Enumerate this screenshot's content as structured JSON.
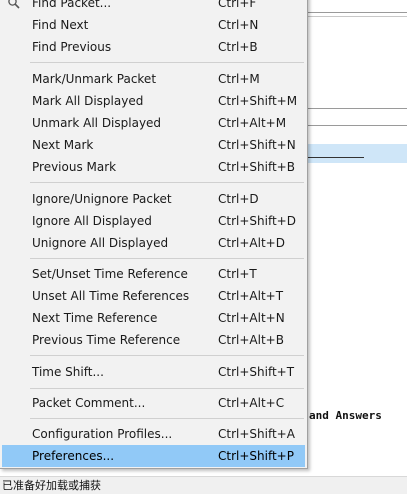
{
  "menu": {
    "items": [
      {
        "label": "Find Packet...",
        "shortcut": "Ctrl+F"
      },
      {
        "label": "Find Next",
        "shortcut": "Ctrl+N"
      },
      {
        "label": "Find Previous",
        "shortcut": "Ctrl+B"
      },
      {
        "label": "Mark/Unmark Packet",
        "shortcut": "Ctrl+M"
      },
      {
        "label": "Mark All Displayed",
        "shortcut": "Ctrl+Shift+M"
      },
      {
        "label": "Unmark All Displayed",
        "shortcut": "Ctrl+Alt+M"
      },
      {
        "label": "Next Mark",
        "shortcut": "Ctrl+Shift+N"
      },
      {
        "label": "Previous Mark",
        "shortcut": "Ctrl+Shift+B"
      },
      {
        "label": "Ignore/Unignore Packet",
        "shortcut": "Ctrl+D"
      },
      {
        "label": "Ignore All Displayed",
        "shortcut": "Ctrl+Shift+D"
      },
      {
        "label": "Unignore All Displayed",
        "shortcut": "Ctrl+Alt+D"
      },
      {
        "label": "Set/Unset Time Reference",
        "shortcut": "Ctrl+T"
      },
      {
        "label": "Unset All Time References",
        "shortcut": "Ctrl+Alt+T"
      },
      {
        "label": "Next Time Reference",
        "shortcut": "Ctrl+Alt+N"
      },
      {
        "label": "Previous Time Reference",
        "shortcut": "Ctrl+Alt+B"
      },
      {
        "label": "Time Shift...",
        "shortcut": "Ctrl+Shift+T"
      },
      {
        "label": "Packet Comment...",
        "shortcut": "Ctrl+Alt+C"
      },
      {
        "label": "Configuration Profiles...",
        "shortcut": "Ctrl+Shift+A"
      },
      {
        "label": "Preferences...",
        "shortcut": "Ctrl+Shift+P",
        "highlighted": true
      }
    ]
  },
  "background": {
    "fragment_text": "and Answers",
    "status_text": "已准备好加载或捕获"
  },
  "colors": {
    "menu_bg": "#f2f2f2",
    "highlight": "#91c9f7",
    "row_select": "#cfe6f8"
  },
  "icons": {
    "find_packet": "search-icon"
  }
}
